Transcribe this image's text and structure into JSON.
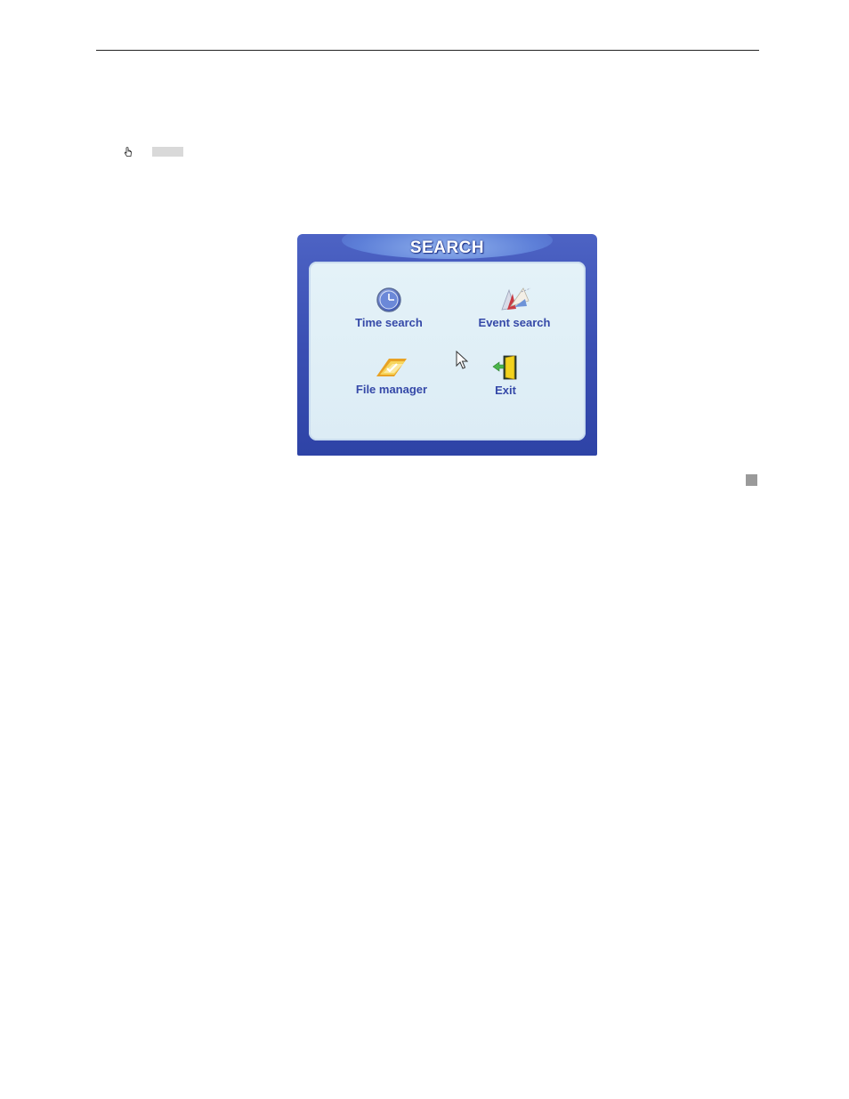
{
  "dialog": {
    "title": "SEARCH",
    "items": [
      {
        "label": "Time search",
        "icon": "clock-icon"
      },
      {
        "label": "Event search",
        "icon": "event-flags-icon"
      },
      {
        "label": "File manager",
        "icon": "folder-icon"
      },
      {
        "label": "Exit",
        "icon": "exit-door-icon"
      }
    ]
  },
  "colors": {
    "dialog_frame": "#3a4fb3",
    "panel_bg": "#e4f2f8",
    "label_text": "#3549a8",
    "title_text": "#ffffff"
  }
}
